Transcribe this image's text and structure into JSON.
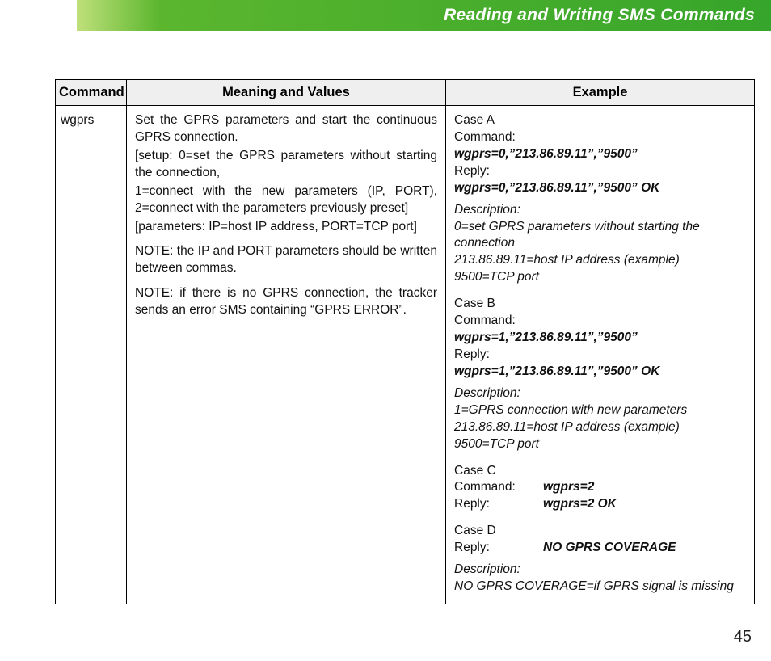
{
  "header": {
    "title": "Reading and Writing SMS Commands"
  },
  "table": {
    "headers": {
      "command": "Command",
      "meaning": "Meaning and Values",
      "example": "Example"
    },
    "row": {
      "command": "wgprs",
      "meaning": {
        "p1": "Set the GPRS parameters and start the continuous GPRS connection.",
        "p2": "[setup: 0=set the GPRS parameters without starting the connection,",
        "p3": "1=connect with the new parameters (IP, PORT), 2=connect with the parameters previously preset]",
        "p4": "[parameters: IP=host IP address, PORT=TCP port]",
        "p5": "NOTE: the IP and PORT parameters should be written between commas.",
        "p6": "NOTE: if there is no GPRS connection, the tracker sends an error SMS containing “GPRS ERROR”."
      },
      "example": {
        "caseA": {
          "title": "Case A",
          "cmd_label": "Command:",
          "cmd_value": "wgprs=0,”213.86.89.11”,”9500”",
          "reply_label": "Reply:",
          "reply_value": "wgprs=0,”213.86.89.11”,”9500” OK",
          "desc_label": "Description:",
          "desc1": "0=set GPRS parameters without starting the connection",
          "desc2": "213.86.89.11=host IP address (example)",
          "desc3": "9500=TCP port"
        },
        "caseB": {
          "title": "Case B",
          "cmd_label": "Command:",
          "cmd_value": "wgprs=1,”213.86.89.11”,”9500”",
          "reply_label": "Reply:",
          "reply_value": "wgprs=1,”213.86.89.11”,”9500” OK",
          "desc_label": "Description:",
          "desc1": "1=GPRS connection with new parameters",
          "desc2": "213.86.89.11=host IP address (example)",
          "desc3": "9500=TCP port"
        },
        "caseC": {
          "title": "Case C",
          "cmd_label": "Command:",
          "cmd_value": "wgprs=2",
          "reply_label": "Reply:",
          "reply_value": "wgprs=2 OK"
        },
        "caseD": {
          "title": "Case D",
          "reply_label": "Reply:",
          "reply_value": "NO GPRS COVERAGE",
          "desc_label": "Description:",
          "desc1": "NO GPRS COVERAGE=if GPRS signal is missing"
        }
      }
    }
  },
  "page_number": "45"
}
